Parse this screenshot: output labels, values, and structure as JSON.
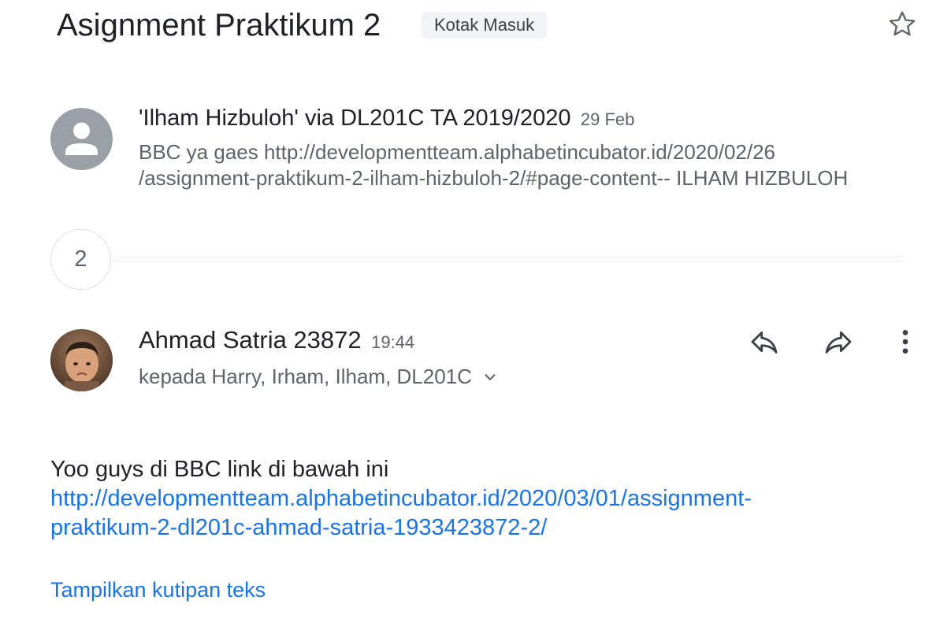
{
  "header": {
    "subject": "Asignment Praktikum 2",
    "label": "Kotak Masuk",
    "star_icon": "star-outline-icon"
  },
  "collapsed_message": {
    "sender": "'Ilham Hizbuloh' via DL201C TA 2019/2020",
    "date": "29 Feb",
    "snippet_line1": "BBC ya gaes http://developmentteam.alphabetincubator.id/2020/02/26",
    "snippet_line2": "/assignment-praktikum-2-ilham-hizbuloh-2/#page-content-- ILHAM HIZBULOH",
    "avatar_icon": "person-icon"
  },
  "collapsed_count": {
    "count": "2"
  },
  "expanded_message": {
    "sender": "Ahmad Satria 23872",
    "time": "19:44",
    "recipients": "kepada Harry, Irham, Ilham, DL201C",
    "actions": {
      "reply_icon": "reply-icon",
      "forward_icon": "forward-icon",
      "more_icon": "more-vert-icon"
    },
    "body": {
      "line1": "Yoo guys di BBC link di bawah ini",
      "link_line1": "http://developmentteam.alphabetincubator.id/2020/03/01/assignment-",
      "link_line2": "praktikum-2-dl201c-ahmad-satria-1933423872-2/"
    },
    "show_quoted": "Tampilkan kutipan teks"
  },
  "colors": {
    "link": "#1a73e8",
    "secondary_text": "#5f6368",
    "chip_bg": "#f1f3f4"
  }
}
